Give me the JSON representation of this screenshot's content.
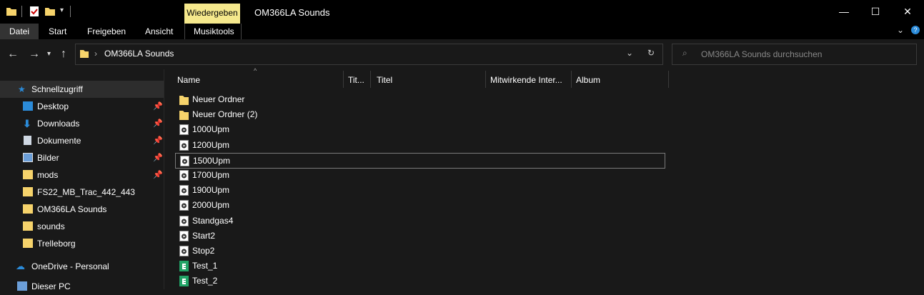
{
  "window": {
    "title": "OM366LA Sounds",
    "context_tab": "Wiedergeben",
    "controls": {
      "minimize": "—",
      "maximize": "☐",
      "close": "✕"
    }
  },
  "ribbon": {
    "tabs": [
      "Datei",
      "Start",
      "Freigeben",
      "Ansicht",
      "Musiktools"
    ],
    "active": "Datei"
  },
  "address": {
    "path": "OM366LA Sounds",
    "search_placeholder": "OM366LA Sounds durchsuchen"
  },
  "sidebar": {
    "items": [
      {
        "label": "Schnellzugriff",
        "icon": "star-icon",
        "pinned": false,
        "selected": true
      },
      {
        "label": "Desktop",
        "icon": "desktop-icon",
        "pinned": true
      },
      {
        "label": "Downloads",
        "icon": "download-icon",
        "pinned": true
      },
      {
        "label": "Dokumente",
        "icon": "document-icon",
        "pinned": true
      },
      {
        "label": "Bilder",
        "icon": "pictures-icon",
        "pinned": true
      },
      {
        "label": "mods",
        "icon": "folder-icon",
        "pinned": true
      },
      {
        "label": "FS22_MB_Trac_442_443",
        "icon": "folder-icon",
        "pinned": false
      },
      {
        "label": "OM366LA Sounds",
        "icon": "folder-icon",
        "pinned": false
      },
      {
        "label": "sounds",
        "icon": "folder-icon",
        "pinned": false
      },
      {
        "label": "Trelleborg",
        "icon": "folder-icon",
        "pinned": false
      },
      {
        "label": "OneDrive - Personal",
        "icon": "cloud-icon",
        "pinned": false
      },
      {
        "label": "Dieser PC",
        "icon": "pc-icon",
        "pinned": false
      }
    ]
  },
  "columns": [
    "Name",
    "Tit...",
    "Titel",
    "Mitwirkende Inter...",
    "Album"
  ],
  "files": [
    {
      "name": "Neuer Ordner",
      "type": "folder"
    },
    {
      "name": "Neuer Ordner (2)",
      "type": "folder"
    },
    {
      "name": "1000Upm",
      "type": "audio"
    },
    {
      "name": "1200Upm",
      "type": "audio"
    },
    {
      "name": "1500Upm",
      "type": "audio",
      "focused": true
    },
    {
      "name": "1700Upm",
      "type": "audio"
    },
    {
      "name": "1900Upm",
      "type": "audio"
    },
    {
      "name": "2000Upm",
      "type": "audio"
    },
    {
      "name": "Standgas4",
      "type": "audio"
    },
    {
      "name": "Start2",
      "type": "audio"
    },
    {
      "name": "Stop2",
      "type": "audio"
    },
    {
      "name": "Test_1",
      "type": "sheet"
    },
    {
      "name": "Test_2",
      "type": "sheet"
    }
  ],
  "colors": {
    "folder": "#f6d36b",
    "accent": "#2b8bd9",
    "sheet": "#21a366",
    "context_tab": "#f5e88c"
  }
}
